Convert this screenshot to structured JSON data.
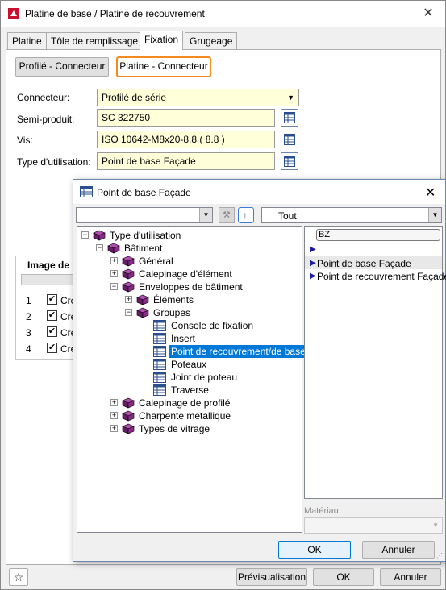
{
  "main_window": {
    "title": "Platine de base / Platine de recouvrement",
    "tabs": [
      {
        "label": "Platine"
      },
      {
        "label": "Tôle de remplissage"
      },
      {
        "label": "Fixation"
      },
      {
        "label": "Grugeage"
      }
    ],
    "subtabs": {
      "profile_connector": "Profilé - Connecteur",
      "plate_connector": "Platine - Connecteur"
    },
    "form": {
      "connector_label": "Connecteur:",
      "connector_value": "Profilé de série",
      "semi_product_label": "Semi-produit:",
      "semi_product_value": "SC  322750",
      "screw_label": "Vis:",
      "screw_value": "ISO 10642-M8x20-8.8  ( 8.8 )",
      "usage_type_label": "Type d'utilisation:",
      "usage_type_value": "Point de base Façade"
    },
    "image_section": {
      "title": "Image de",
      "rows": [
        {
          "num": "1",
          "label": "Cré"
        },
        {
          "num": "2",
          "label": "Cré"
        },
        {
          "num": "3",
          "label": "Cré"
        },
        {
          "num": "4",
          "label": "Cré"
        }
      ]
    },
    "footer": {
      "preview": "Prévisualisation",
      "ok": "OK",
      "cancel": "Annuler"
    }
  },
  "dialog": {
    "title": "Point de base Façade",
    "filter_value": "Tout",
    "tree": {
      "root": "Type d'utilisation",
      "batiment": "Bâtiment",
      "general": "Général",
      "calepinage_element": "Calepinage d'élément",
      "enveloppes": "Enveloppes de bâtiment",
      "elements": "Éléments",
      "groupes": "Groupes",
      "console": "Console de fixation",
      "insert": "Insert",
      "point_recouvrement": "Point de recouvrement/de base",
      "poteaux": "Poteaux",
      "joint": "Joint de poteau",
      "traverse": "Traverse",
      "calepinage_profile": "Calepinage de profilé",
      "charpente": "Charpente métallique",
      "vitrage": "Types de vitrage"
    },
    "right_pane": {
      "header": "BZ",
      "items": [
        {
          "label": "Point de base Façade"
        },
        {
          "label": "Point de recouvrement Façade"
        }
      ]
    },
    "material_label": "Matériau",
    "ok": "OK",
    "cancel": "Annuler"
  },
  "colors": {
    "accent": "#f28a1e",
    "selection": "#0078d7",
    "field_bg": "#ffffd9",
    "book_purple": "#8a2a8a"
  }
}
